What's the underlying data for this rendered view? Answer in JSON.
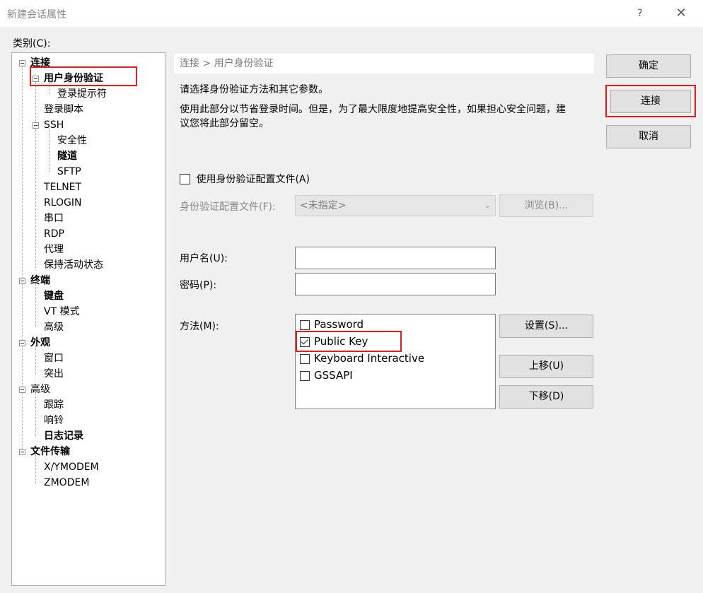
{
  "window": {
    "title": "新建会话属性",
    "help": "?",
    "close": "✕"
  },
  "category_label": "类别(C):",
  "tree": [
    {
      "label": "连接",
      "bold": true
    },
    {
      "label": "用户身份验证",
      "bold": true
    },
    {
      "label": "登录提示符",
      "bold": false
    },
    {
      "label": "登录脚本",
      "bold": false
    },
    {
      "label": "SSH",
      "bold": false
    },
    {
      "label": "安全性",
      "bold": false
    },
    {
      "label": "隧道",
      "bold": true
    },
    {
      "label": "SFTP",
      "bold": false
    },
    {
      "label": "TELNET",
      "bold": false
    },
    {
      "label": "RLOGIN",
      "bold": false
    },
    {
      "label": "串口",
      "bold": false
    },
    {
      "label": "RDP",
      "bold": false
    },
    {
      "label": "代理",
      "bold": false
    },
    {
      "label": "保持活动状态",
      "bold": false
    },
    {
      "label": "终端",
      "bold": true
    },
    {
      "label": "键盘",
      "bold": true
    },
    {
      "label": "VT 模式",
      "bold": false
    },
    {
      "label": "高级",
      "bold": false
    },
    {
      "label": "外观",
      "bold": true
    },
    {
      "label": "窗口",
      "bold": false
    },
    {
      "label": "突出",
      "bold": false
    },
    {
      "label": "高级",
      "bold": false
    },
    {
      "label": "跟踪",
      "bold": false
    },
    {
      "label": "响铃",
      "bold": false
    },
    {
      "label": "日志记录",
      "bold": true
    },
    {
      "label": "文件传输",
      "bold": true
    },
    {
      "label": "X/YMODEM",
      "bold": false
    },
    {
      "label": "ZMODEM",
      "bold": false
    }
  ],
  "breadcrumb": "连接 > 用户身份验证",
  "description": {
    "line1": "请选择身份验证方法和其它参数。",
    "line2a": "使用此部分以节省登录时间。但是，为了最大限度地提高安全性，如果担心安全问题，建",
    "line2b": "议您将此部分留空。"
  },
  "use_profile": {
    "label": "使用身份验证配置文件(A)",
    "checked": false
  },
  "profile": {
    "label": "身份验证配置文件(F):",
    "value": "<未指定>",
    "browse": "浏览(B)..."
  },
  "username": {
    "label": "用户名(U):",
    "value": ""
  },
  "password": {
    "label": "密码(P):",
    "value": ""
  },
  "method": {
    "label": "方法(M):",
    "items": [
      {
        "label": "Password",
        "checked": false
      },
      {
        "label": "Public Key",
        "checked": true
      },
      {
        "label": "Keyboard Interactive",
        "checked": false
      },
      {
        "label": "GSSAPI",
        "checked": false
      }
    ],
    "settings": "设置(S)...",
    "move_up": "上移(U)",
    "move_down": "下移(D)"
  },
  "buttons": {
    "ok": "确定",
    "connect": "连接",
    "cancel": "取消"
  },
  "colors": {
    "highlight": "#e81b1b"
  }
}
